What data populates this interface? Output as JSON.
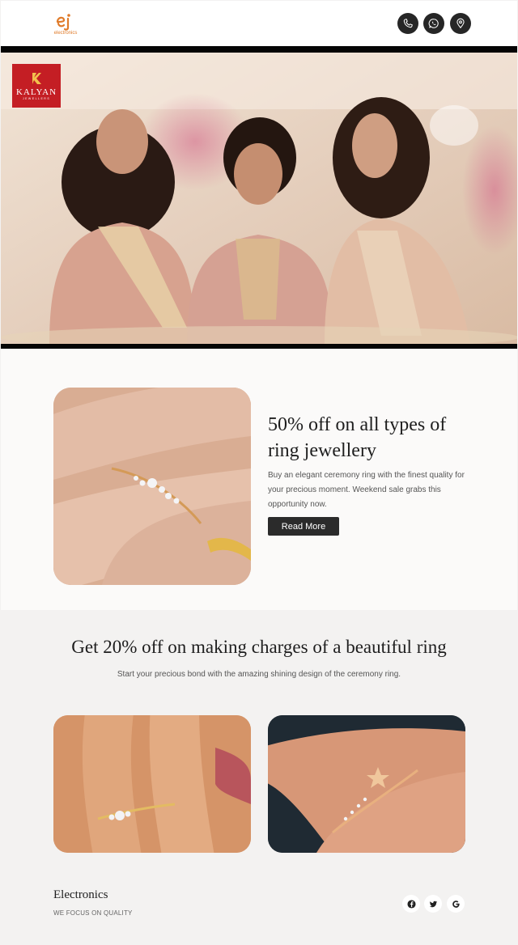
{
  "header": {
    "logo_text": "electronics",
    "icons": [
      "phone-icon",
      "whatsapp-icon",
      "location-pin-icon"
    ]
  },
  "hero": {
    "brand_name": "KALYAN",
    "brand_sub": "JEWELLERS"
  },
  "offer": {
    "title": "50% off on all types of ring jewellery",
    "text": "Buy an elegant ceremony ring with the finest quality for your precious moment. Weekend sale grabs this opportunity now.",
    "button_label": "Read More"
  },
  "section2": {
    "title": "Get 20% off on making charges of a beautiful ring",
    "subtitle": "Start your precious bond with the amazing shining design of the ceremony ring."
  },
  "footer": {
    "title": "Electronics",
    "tagline": "WE FOCUS ON QUALITY",
    "social": [
      "facebook-icon",
      "twitter-icon",
      "google-icon"
    ]
  },
  "colors": {
    "dark": "#262626",
    "brand_red": "#c41e24",
    "logo_orange": "#e07b2a",
    "section_bg": "#f3f2f1"
  }
}
